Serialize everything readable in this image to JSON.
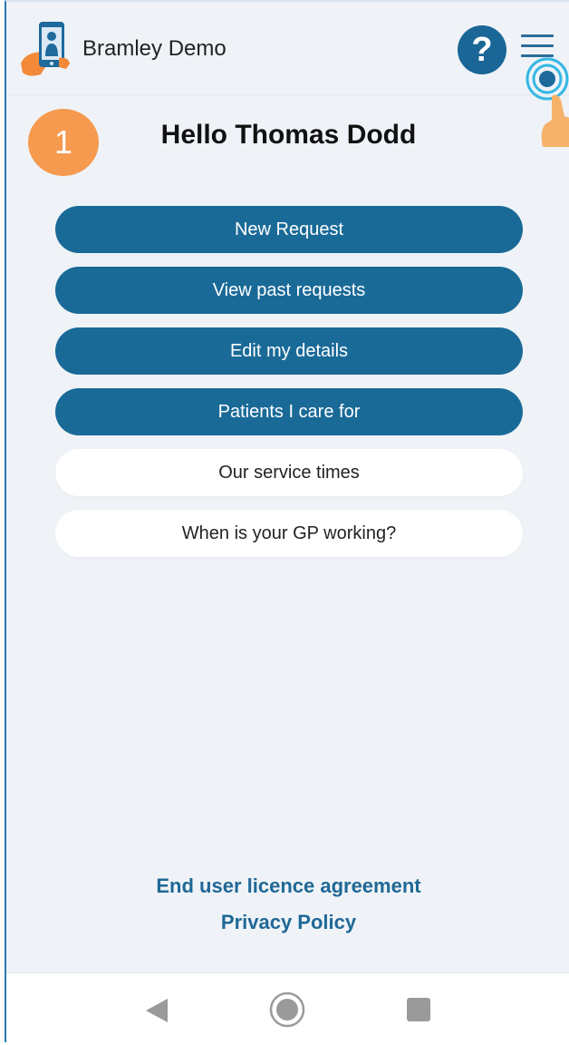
{
  "header": {
    "app_title": "Bramley Demo",
    "help_label": "?",
    "logo_icon": "phone-hand-logo-icon",
    "menu_icon": "hamburger-menu-icon"
  },
  "step_badge": "1",
  "greeting": "Hello Thomas Dodd",
  "buttons": {
    "primary": [
      {
        "label": "New Request"
      },
      {
        "label": "View past requests"
      },
      {
        "label": "Edit my details"
      },
      {
        "label": "Patients I care for"
      }
    ],
    "secondary": [
      {
        "label": "Our service times"
      },
      {
        "label": "When is your GP working?"
      }
    ]
  },
  "footer": {
    "eula": "End user licence agreement",
    "privacy": "Privacy Policy"
  },
  "navbar": {
    "back_icon": "back-triangle-icon",
    "home_icon": "home-circle-icon",
    "recent_icon": "recent-apps-square-icon"
  },
  "colors": {
    "primary": "#1a6a98",
    "badge": "#f59a4f",
    "background": "#eff3f7",
    "link": "#1f6896"
  }
}
